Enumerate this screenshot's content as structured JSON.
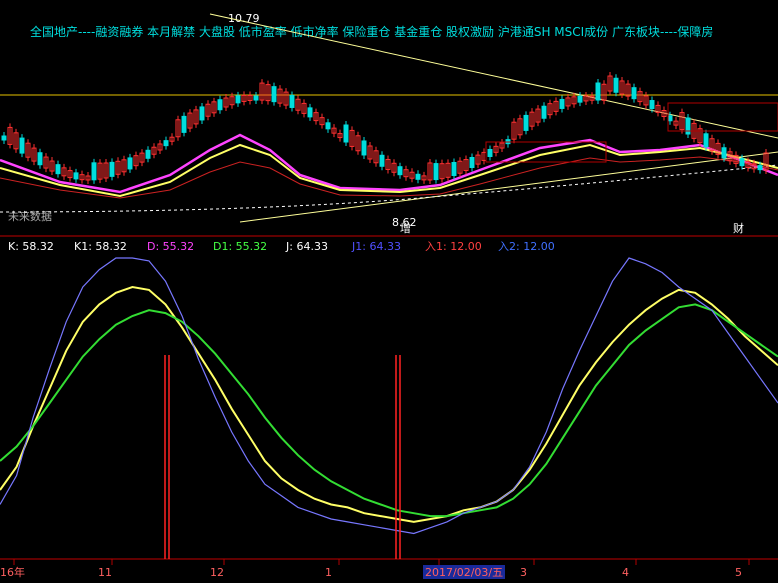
{
  "header": {
    "tags": "全国地产----融资融券 本月解禁 大盘股 低市盈率 低市净率 保险重仓 基金重仓 股权激励 沪港通SH MSCI成份 广东板块----保障房",
    "price_high_label": "10.79",
    "price_low_label": "8.62"
  },
  "upper_panel": {
    "left_note": "未来数据",
    "markers": [
      "增",
      "财"
    ]
  },
  "indicator_legend": [
    {
      "text": "K: 58.32",
      "color": "#ffffff"
    },
    {
      "text": "K1: 58.32",
      "color": "#ffffff"
    },
    {
      "text": "D: 55.32",
      "color": "#ff44ff"
    },
    {
      "text": "D1: 55.32",
      "color": "#44ff44"
    },
    {
      "text": "J: 64.33",
      "color": "#ffffff"
    },
    {
      "text": "J1: 64.33",
      "color": "#5050ff"
    },
    {
      "text": "入1: 12.00",
      "color": "#ff4040"
    },
    {
      "text": "入2: 12.00",
      "color": "#4070ff"
    }
  ],
  "x_axis": {
    "labels": [
      "16年",
      "11",
      "12",
      "1",
      "2017/02/03/五",
      "3",
      "4",
      "5"
    ]
  },
  "colors": {
    "background": "#000000",
    "up": "#ff3030",
    "down": "#00dddd",
    "ma_white": "#ffffff",
    "ma_yellow": "#ffff66",
    "ma_magenta": "#ff44ff",
    "ma_red": "#cc2222",
    "kdj_k": "#ffff66",
    "kdj_d": "#33dd33",
    "kdj_j": "#7777ff",
    "signal": "#ff2222",
    "grid": "#b00000"
  },
  "chart_data": [
    {
      "type": "line",
      "title": "",
      "series": [
        {
          "values": [
            20,
            28,
            42,
            55,
            68,
            78,
            84,
            88,
            90,
            89,
            84,
            76,
            67,
            58,
            48,
            39,
            30,
            24,
            20,
            17,
            15,
            14,
            12,
            11,
            10,
            9,
            10,
            11,
            13,
            14,
            16,
            20,
            27,
            36,
            46,
            56,
            64,
            71,
            77,
            82,
            86,
            89,
            88,
            84,
            79,
            73,
            68,
            63
          ]
        },
        {
          "values": [
            30,
            35,
            42,
            50,
            58,
            66,
            72,
            77,
            80,
            82,
            81,
            78,
            73,
            67,
            60,
            53,
            45,
            38,
            32,
            27,
            23,
            20,
            17,
            15,
            13,
            12,
            11,
            11,
            12,
            13,
            14,
            17,
            22,
            29,
            38,
            47,
            56,
            63,
            70,
            75,
            79,
            83,
            84,
            82,
            78,
            74,
            70,
            66
          ]
        },
        {
          "values": [
            15,
            25,
            45,
            62,
            78,
            90,
            96,
            100,
            100,
            99,
            92,
            80,
            65,
            52,
            40,
            30,
            22,
            18,
            14,
            12,
            10,
            9,
            8,
            7,
            6,
            5,
            7,
            9,
            12,
            14,
            16,
            20,
            28,
            40,
            55,
            68,
            80,
            92,
            100,
            98,
            95,
            90,
            86,
            82,
            74,
            66,
            58,
            50
          ]
        }
      ]
    }
  ]
}
